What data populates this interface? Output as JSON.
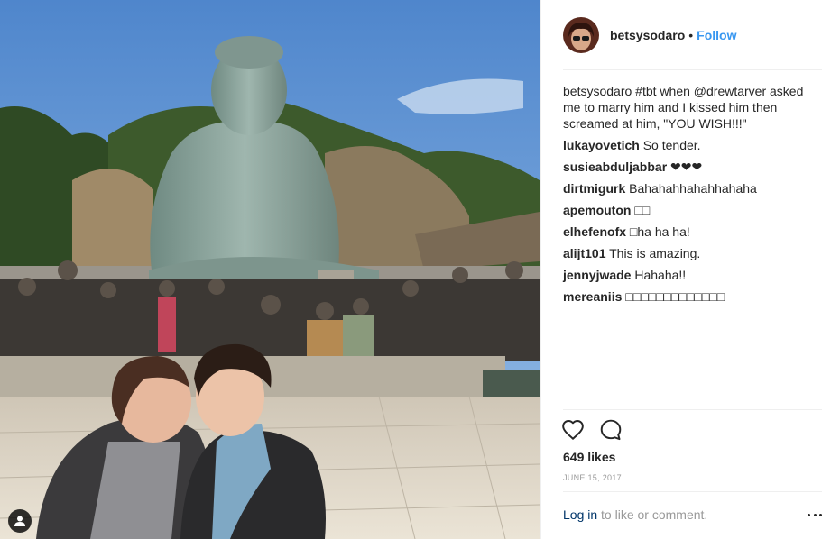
{
  "post": {
    "username": "betsysodaro",
    "separator": "•",
    "follow_label": "Follow",
    "caption": {
      "username": "betsysodaro",
      "hashtag": "#tbt",
      "text_1": " when ",
      "mention": "@drewtarver",
      "text_2": " asked me to marry him and I kissed him then screamed at him, \"YOU WISH!!!\""
    },
    "comments": [
      {
        "user": "lukayovetich",
        "text": "So tender."
      },
      {
        "user": "susieabduljabbar",
        "text": "❤❤❤"
      },
      {
        "user": "dirtmigurk",
        "text": "Bahahahhahahhahaha"
      },
      {
        "user": "apemouton",
        "text": "□□"
      },
      {
        "user": "elhefenofx",
        "text": "□ha ha ha!"
      },
      {
        "user": "alijt101",
        "text": "This is amazing."
      },
      {
        "user": "jennyjwade",
        "text": "Hahaha!!"
      },
      {
        "user": "mereaniis",
        "text": "□□□□□□□□□□□□□"
      }
    ],
    "likes": "649 likes",
    "date": "June 15, 2017",
    "login_link": "Log in",
    "login_text": " to like or comment."
  },
  "icons": {
    "like": "heart-icon",
    "comment": "comment-bubble-icon",
    "more": "more-options-icon",
    "tag": "user-tag-icon"
  },
  "colors": {
    "link_blue": "#3897f0",
    "mention_blue": "#003569",
    "muted": "#999999",
    "text": "#262626"
  }
}
